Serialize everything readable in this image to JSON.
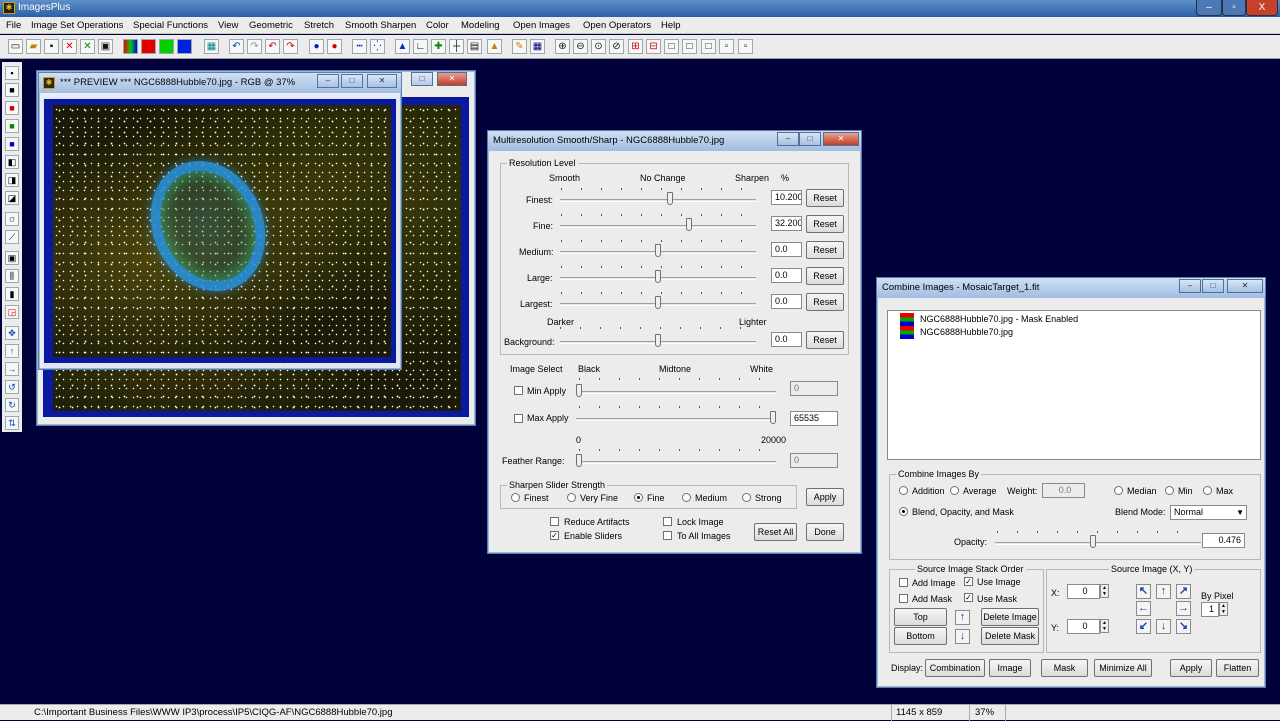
{
  "app": {
    "title": "ImagesPlus",
    "close": "X"
  },
  "menu": [
    "File",
    "Image Set Operations",
    "Special Functions",
    "View",
    "Geometric",
    "Stretch",
    "Smooth Sharpen",
    "Color",
    "Modeling",
    "Open Images",
    "Open Operators",
    "Help"
  ],
  "preview": {
    "title": "*** PREVIEW *** NGC6888Hubble70.jpg - RGB @ 37%"
  },
  "msharp": {
    "title": "Multiresolution Smooth/Sharp - NGC6888Hubble70.jpg",
    "res_group": "Resolution Level",
    "h_smooth": "Smooth",
    "h_nochange": "No Change",
    "h_sharpen": "Sharpen",
    "h_pct": "%",
    "rows": [
      {
        "label": "Finest:",
        "value": "10.200",
        "pos": 0.56
      },
      {
        "label": "Fine:",
        "value": "32.200",
        "pos": 0.66
      },
      {
        "label": "Medium:",
        "value": "0.0",
        "pos": 0.5
      },
      {
        "label": "Large:",
        "value": "0.0",
        "pos": 0.5
      },
      {
        "label": "Largest:",
        "value": "0.0",
        "pos": 0.5
      }
    ],
    "reset": "Reset",
    "h_darker": "Darker",
    "h_lighter": "Lighter",
    "bg_label": "Background:",
    "bg_value": "0.0",
    "img_select": "Image Select",
    "h_black": "Black",
    "h_midtone": "Midtone",
    "h_white": "White",
    "min_apply": "Min Apply",
    "min_value": "0",
    "max_apply": "Max Apply",
    "max_value": "65535",
    "range_min": "0",
    "range_max": "20000",
    "feather_label": "Feather Range:",
    "feather_value": "0",
    "strength_group": "Sharpen Slider Strength",
    "strengths": [
      "Finest",
      "Very Fine",
      "Fine",
      "Medium",
      "Strong"
    ],
    "strength_selected": 2,
    "apply": "Apply",
    "reduce_artifacts": "Reduce Artifacts",
    "enable_sliders": "Enable Sliders",
    "lock_image": "Lock Image",
    "to_all_images": "To All Images",
    "reset_all": "Reset All",
    "done": "Done"
  },
  "combine": {
    "title": "Combine Images - MosaicTarget_1.fit",
    "layers": [
      "NGC6888Hubble70.jpg - Mask Enabled",
      "NGC6888Hubble70.jpg"
    ],
    "by_group": "Combine Images By",
    "addition": "Addition",
    "average": "Average",
    "weight_label": "Weight:",
    "weight_value": "0.0",
    "median": "Median",
    "min": "Min",
    "max": "Max",
    "blend": "Blend, Opacity, and Mask",
    "blend_mode_label": "Blend Mode:",
    "blend_mode": "Normal",
    "opacity_label": "Opacity:",
    "opacity_value": "0.476",
    "opacity_pos": 0.476,
    "stack_group": "Source Image Stack Order",
    "add_image": "Add Image",
    "use_image": "Use Image",
    "add_mask": "Add Mask",
    "use_mask": "Use Mask",
    "top": "Top",
    "bottom": "Bottom",
    "delete_image": "Delete Image",
    "delete_mask": "Delete Mask",
    "xy_group": "Source Image (X, Y)",
    "x_label": "X:",
    "x_value": "0",
    "y_label": "Y:",
    "y_value": "0",
    "by_pixel": "By Pixel",
    "pixel_value": "1",
    "display_label": "Display:",
    "btn_combination": "Combination",
    "btn_image": "Image",
    "btn_mask": "Mask",
    "minimize_all": "Minimize All",
    "apply": "Apply",
    "flatten": "Flatten"
  },
  "status": {
    "path": "C:\\Important Business Files\\WWW IP3\\process\\IP5\\CIQG-AF\\NGC6888Hubble70.jpg",
    "dims": "1145 x 859",
    "zoom": "37%"
  },
  "colors": {
    "desktop": "#00003a",
    "titlebar": "#2b5fa6",
    "image_frame": "#0a1aa0"
  }
}
